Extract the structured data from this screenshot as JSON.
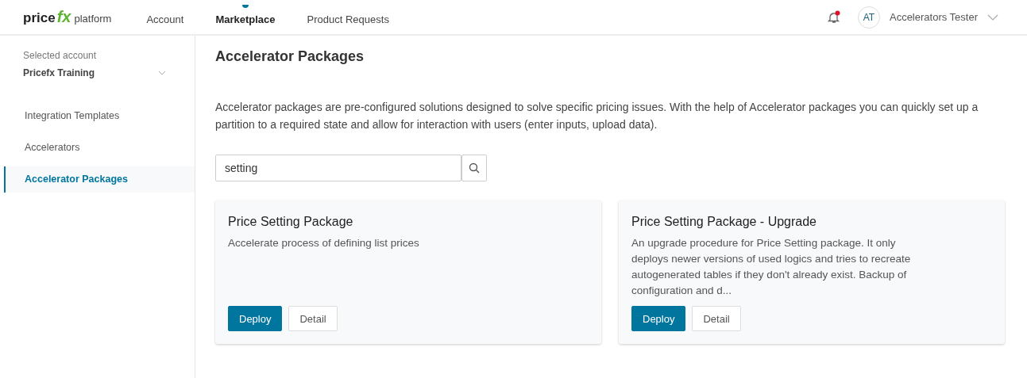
{
  "logo": {
    "brand": "price",
    "mark": "fx",
    "product": "platform"
  },
  "nav": [
    {
      "label": "Account",
      "selected": false
    },
    {
      "label": "Marketplace",
      "selected": true
    },
    {
      "label": "Product Requests",
      "selected": false
    }
  ],
  "user": {
    "notification": true,
    "initials": "AT",
    "name": "Accelerators Tester"
  },
  "sidebar": {
    "account_label": "Selected account",
    "account": "Pricefx Training",
    "items": [
      {
        "label": "Integration Templates",
        "selected": false
      },
      {
        "label": "Accelerators",
        "selected": false
      },
      {
        "label": "Accelerator Packages",
        "selected": true
      }
    ]
  },
  "page": {
    "title": "Accelerator Packages",
    "description": "Accelerator packages are pre-configured solutions designed to solve specific pricing issues. With the help of Accelerator packages you can quickly set up a partition to a required state and allow for interaction with users (enter inputs, upload data).",
    "search": {
      "value": "setting"
    }
  },
  "cards": [
    {
      "title": "Price Setting Package",
      "description": "Accelerate process of defining list prices",
      "buttons": [
        "Deploy",
        "Detail"
      ]
    },
    {
      "title": "Price Setting Package - Upgrade",
      "description": "An upgrade procedure for Price Setting package. It only deploys newer versions of used logics and tries to recreate autogenerated tables if they don't already exist. Backup of configuration and d...",
      "buttons": [
        "Deploy",
        "Detail"
      ]
    }
  ]
}
